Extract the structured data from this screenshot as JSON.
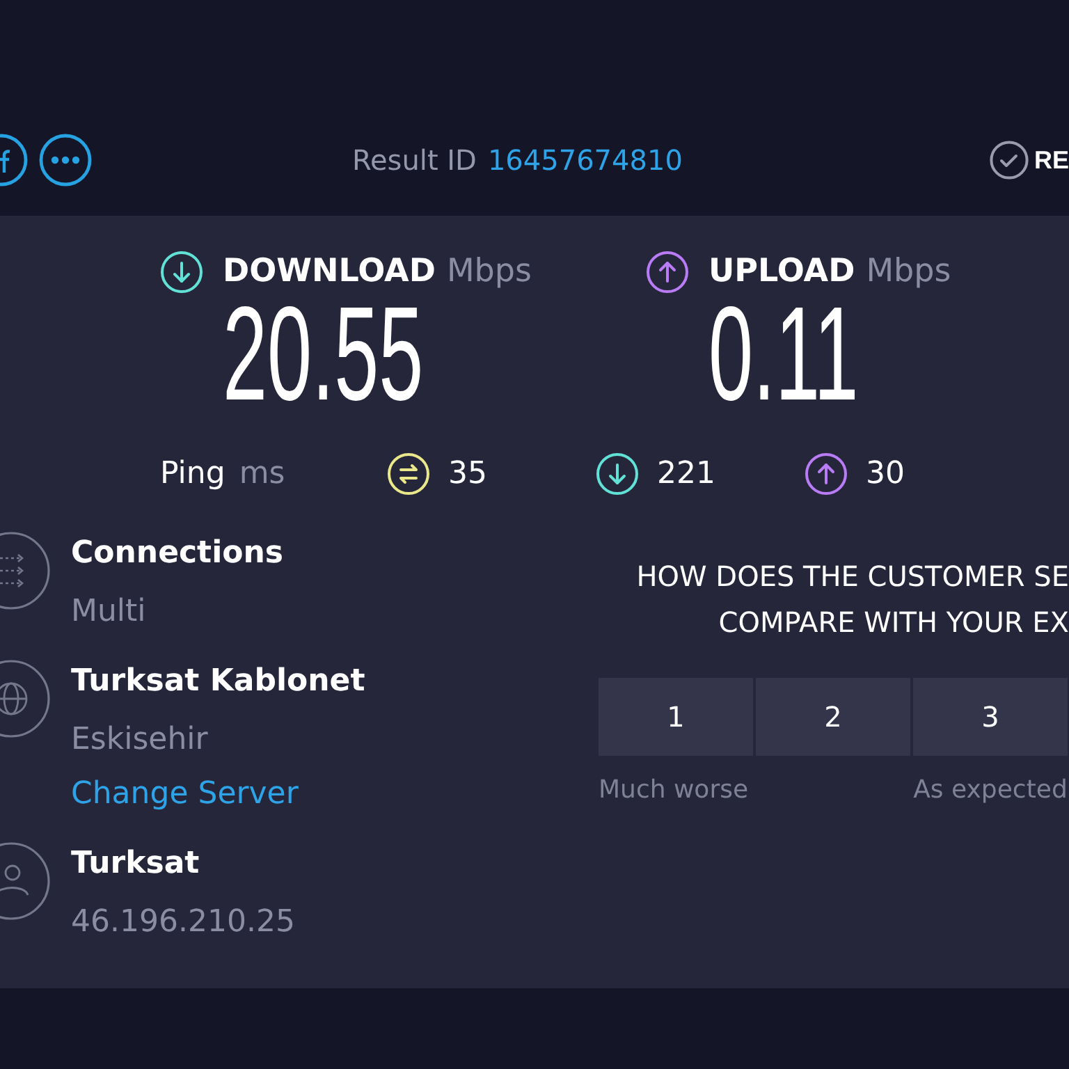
{
  "header": {
    "result_label": "Result ID",
    "result_id": "16457674810",
    "action": "RE"
  },
  "speeds": [
    {
      "kind": "download",
      "label": "DOWNLOAD",
      "unit": "Mbps",
      "value": "20.55"
    },
    {
      "kind": "upload",
      "label": "UPLOAD",
      "unit": "Mbps",
      "value": "0.11"
    }
  ],
  "ping": {
    "label": "Ping",
    "unit": "ms",
    "readings": [
      {
        "kind": "idle",
        "value": "35"
      },
      {
        "kind": "download",
        "value": "221"
      },
      {
        "kind": "upload",
        "value": "30"
      }
    ]
  },
  "details": [
    {
      "kind": "connections",
      "title": "Connections",
      "lines": [
        {
          "kind": "text",
          "text": "Multi"
        }
      ]
    },
    {
      "kind": "server",
      "title": "Turksat Kablonet",
      "lines": [
        {
          "kind": "text",
          "text": "Eskisehir"
        },
        {
          "kind": "link",
          "text": "Change Server"
        }
      ]
    },
    {
      "kind": "provider",
      "title": "Turksat",
      "lines": [
        {
          "kind": "text",
          "text": "46.196.210.25"
        }
      ]
    }
  ],
  "survey": {
    "question_lines": [
      "HOW DOES THE CUSTOMER SE",
      "COMPARE WITH YOUR EX"
    ],
    "ratings": [
      {
        "label": "1",
        "selected": false
      },
      {
        "label": "2",
        "selected": false
      },
      {
        "label": "3",
        "selected": false
      }
    ],
    "scale_labels": [
      "Much worse",
      "As expected"
    ]
  }
}
